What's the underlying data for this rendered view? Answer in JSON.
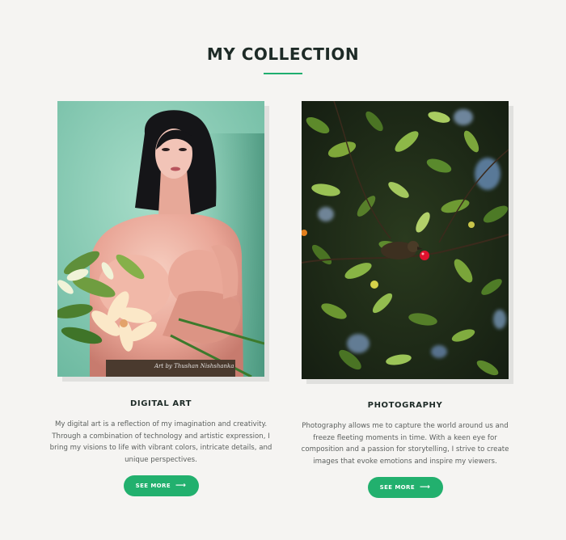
{
  "section": {
    "title": "MY COLLECTION"
  },
  "colors": {
    "accent": "#22b06e",
    "background": "#f5f4f2",
    "heading": "#1e2b27",
    "body_text": "#5b5f5d"
  },
  "cards": [
    {
      "title": "DIGITAL ART",
      "image_signature": "Art by Thushan Nishshanka",
      "description": "My digital art is a reflection of my imagination and creativity. Through a combination of technology and artistic expression, I bring my visions to life with vibrant colors, intricate details, and unique perspectives.",
      "button_label": "SEE MORE",
      "button_icon": "arrow-right-icon"
    },
    {
      "title": "PHOTOGRAPHY",
      "description": "Photography allows me to capture the world around us and freeze fleeting moments in time. With a keen eye for composition and a passion for storytelling, I strive to create images that evoke emotions and inspire my viewers.",
      "button_label": "SEE MORE",
      "button_icon": "arrow-right-icon"
    }
  ]
}
